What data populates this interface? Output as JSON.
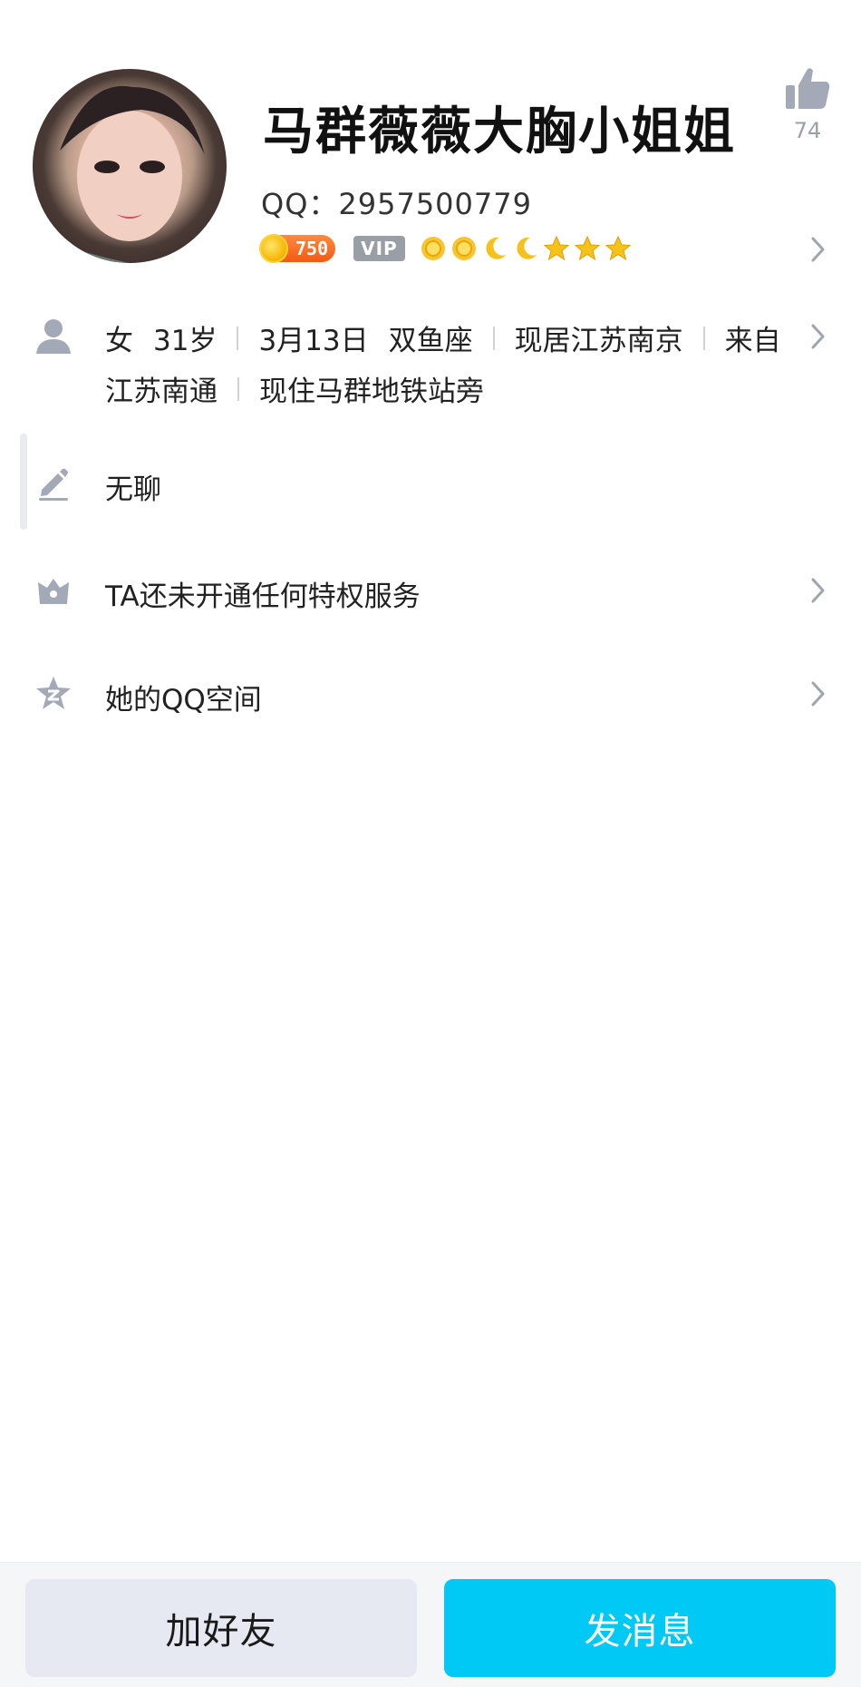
{
  "profile": {
    "nickname": "马群薇薇大胸小姐姐",
    "qq_label": "QQ：2957500779",
    "like_count": "74",
    "coin_level": "750",
    "vip_label": "VIP",
    "level_icons": [
      "sun-icon",
      "sun-icon",
      "moon-icon",
      "moon-icon",
      "star-icon",
      "star-icon",
      "star-icon"
    ]
  },
  "info": {
    "gender": "女",
    "age": "31岁",
    "birthday": "3月13日",
    "zodiac": "双鱼座",
    "current_city": "现居江苏南京",
    "hometown_prefix": "来自",
    "hometown": "江苏南通",
    "location_note": "现住马群地铁站旁"
  },
  "signature": {
    "text": "无聊"
  },
  "privilege": {
    "text": "TA还未开通任何特权服务"
  },
  "qzone": {
    "text": "她的QQ空间"
  },
  "actions": {
    "add_friend": "加好友",
    "send_message": "发消息"
  },
  "colors": {
    "primary": "#00c9f5",
    "secondary_button": "#e6e9f2",
    "icon_gray": "#a4a9b8",
    "coin_orange": "#f25a14"
  }
}
